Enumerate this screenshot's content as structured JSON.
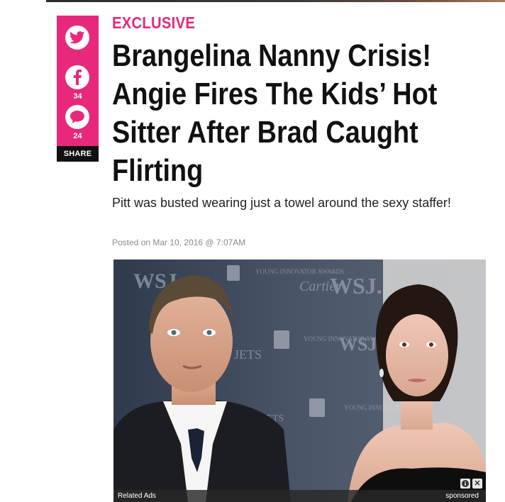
{
  "share": {
    "twitter_icon": "twitter-bird-icon",
    "facebook_icon": "facebook-f-icon",
    "facebook_count": "34",
    "comment_icon": "speech-bubble-icon",
    "comment_count": "24",
    "label": "SHARE",
    "accent": "#e8287a"
  },
  "article": {
    "kicker": "EXCLUSIVE",
    "headline": "Brangelina Nanny Crisis! Angie Fires The Kids’ Hot Sitter After Brad Caught Flirting",
    "dek": "Pitt was busted wearing just a towel around the sexy staffer!",
    "posted": "Posted on Mar 10, 2016 @ 7:07AM"
  },
  "photo_backdrop_text": [
    "WSJ.",
    "Cartier",
    "YOUNG INNOVATOR AWARDS",
    "JETS",
    "JETS"
  ],
  "ad": {
    "left_label": "Related Ads",
    "right_label": "sponsored",
    "info_icon": "info-icon",
    "close_icon": "close-icon"
  }
}
